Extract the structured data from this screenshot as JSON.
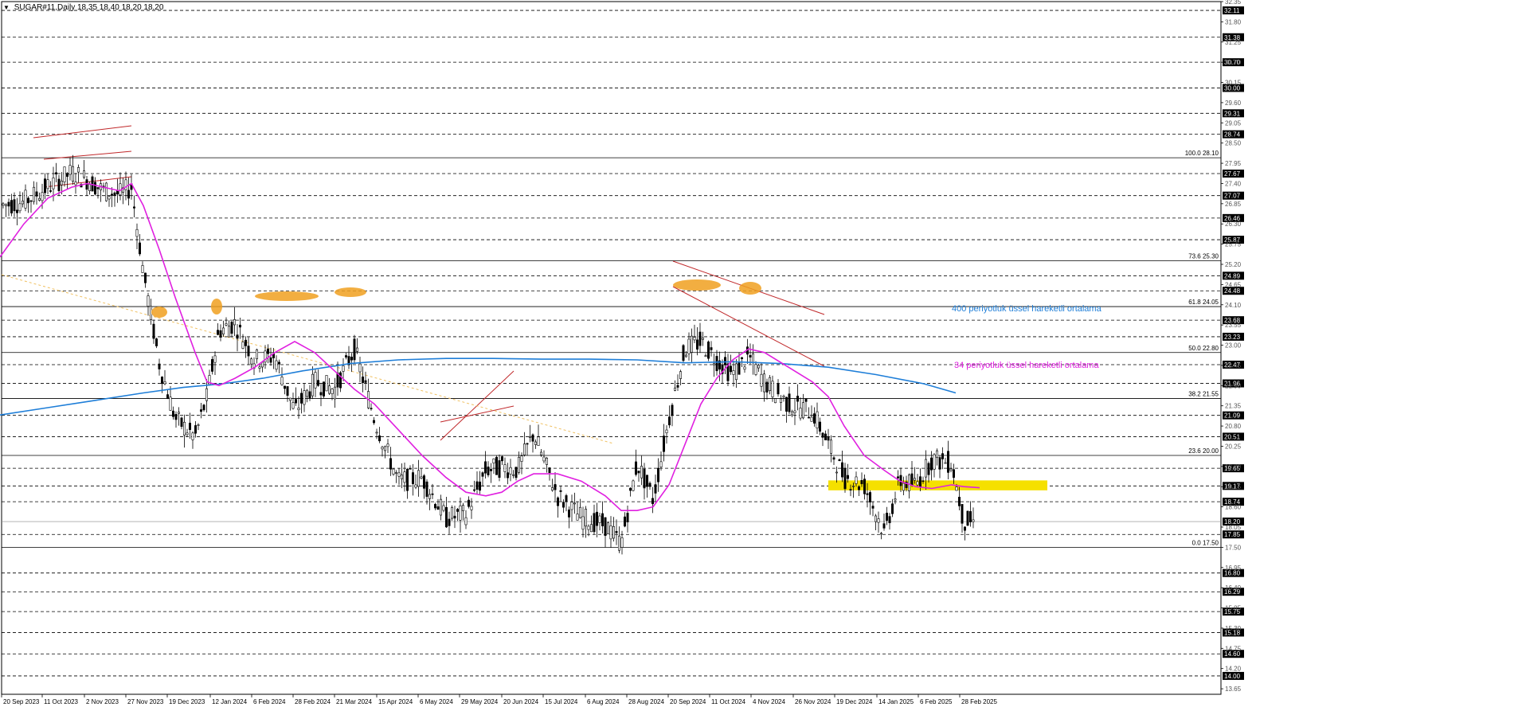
{
  "header": {
    "symbol": "SUGAR#11,Daily",
    "ohlc": "18.35 18.40 18.20 18.20"
  },
  "colors": {
    "background": "#ffffff",
    "candle": "#000000",
    "ema34": "#e020e0",
    "ema400": "#1e7ed8",
    "fib": "#000000",
    "support_zone": "#f5e000",
    "turn_marker": "#f0a020",
    "channel": "#c0282a",
    "long_trend": "#f0c060",
    "price_box": "#000000"
  },
  "chart_data": {
    "type": "candlestick",
    "title": "SUGAR#11,Daily",
    "ylim": [
      13.5,
      32.35
    ],
    "current_price": "18.20",
    "y_ticks": [
      "32.35",
      "31.80",
      "31.25",
      "30.70",
      "30.15",
      "29.60",
      "29.05",
      "28.50",
      "27.95",
      "27.40",
      "26.85",
      "26.30",
      "25.75",
      "25.20",
      "24.65",
      "24.10",
      "23.55",
      "23.00",
      "22.45",
      "21.90",
      "21.35",
      "20.80",
      "20.25",
      "19.70",
      "19.15",
      "18.60",
      "18.05",
      "17.50",
      "16.95",
      "16.40",
      "15.85",
      "15.30",
      "14.75",
      "14.20",
      "13.65"
    ],
    "x_labels": [
      "20 Sep 2023",
      "11 Oct 2023",
      "2 Nov 2023",
      "27 Nov 2023",
      "19 Dec 2023",
      "12 Jan 2024",
      "6 Feb 2024",
      "28 Feb 2024",
      "21 Mar 2024",
      "15 Apr 2024",
      "6 May 2024",
      "29 May 2024",
      "20 Jun 2024",
      "15 Jul 2024",
      "6 Aug 2024",
      "28 Aug 2024",
      "20 Sep 2024",
      "11 Oct 2024",
      "4 Nov 2024",
      "26 Nov 2024",
      "19 Dec 2024",
      "14 Jan 2025",
      "6 Feb 2025",
      "28 Feb 2025"
    ],
    "price_levels": [
      {
        "value": 32.11,
        "label": "32.11"
      },
      {
        "value": 31.38,
        "label": "31.38"
      },
      {
        "value": 30.7,
        "label": "30.70"
      },
      {
        "value": 30.0,
        "label": "30.00"
      },
      {
        "value": 29.31,
        "label": "29.31"
      },
      {
        "value": 28.74,
        "label": "28.74"
      },
      {
        "value": 27.67,
        "label": "27.67"
      },
      {
        "value": 27.07,
        "label": "27.07"
      },
      {
        "value": 26.46,
        "label": "26.46"
      },
      {
        "value": 25.87,
        "label": "25.87"
      },
      {
        "value": 24.89,
        "label": "24.89"
      },
      {
        "value": 24.48,
        "label": "24.48"
      },
      {
        "value": 23.68,
        "label": "23.68"
      },
      {
        "value": 23.23,
        "label": "23.23"
      },
      {
        "value": 22.47,
        "label": "22.47"
      },
      {
        "value": 21.96,
        "label": "21.96"
      },
      {
        "value": 21.09,
        "label": "21.09"
      },
      {
        "value": 20.51,
        "label": "20.51"
      },
      {
        "value": 19.65,
        "label": "19.65"
      },
      {
        "value": 19.17,
        "label": "19.17"
      },
      {
        "value": 18.74,
        "label": "18.74"
      },
      {
        "value": 17.85,
        "label": "17.85"
      },
      {
        "value": 16.8,
        "label": "16.80"
      },
      {
        "value": 16.29,
        "label": "16.29"
      },
      {
        "value": 15.75,
        "label": "15.75"
      },
      {
        "value": 15.18,
        "label": "15.18"
      },
      {
        "value": 14.6,
        "label": "14.60"
      },
      {
        "value": 14.0,
        "label": "14.00"
      }
    ],
    "fib_levels": [
      {
        "value": 28.1,
        "label": "100.0 28.10"
      },
      {
        "value": 25.3,
        "label": "73.6 25.30"
      },
      {
        "value": 24.05,
        "label": "61.8 24.05"
      },
      {
        "value": 22.8,
        "label": "50.0 22.80"
      },
      {
        "value": 21.55,
        "label": "38.2 21.55"
      },
      {
        "value": 20.0,
        "label": "23.6 20.00"
      },
      {
        "value": 17.5,
        "label": "0.0 17.50"
      }
    ],
    "series": [
      {
        "name": "400 periyotluk üssel hareketli ortalama",
        "x": [
          0,
          60,
          120,
          180,
          230,
          280,
          330,
          380,
          440,
          500,
          560,
          620,
          680,
          740,
          800,
          860,
          920,
          980,
          1040,
          1100,
          1160,
          1200
        ],
        "values": [
          21.1,
          21.3,
          21.5,
          21.7,
          21.85,
          21.95,
          22.1,
          22.3,
          22.5,
          22.6,
          22.64,
          22.64,
          22.62,
          22.62,
          22.6,
          22.52,
          22.55,
          22.5,
          22.4,
          22.2,
          21.95,
          21.7
        ]
      },
      {
        "name": "34 periyotluk üssel hareketli ortalama",
        "x": [
          0,
          30,
          60,
          90,
          110,
          130,
          150,
          165,
          180,
          200,
          220,
          245,
          260,
          275,
          295,
          320,
          345,
          370,
          395,
          420,
          445,
          470,
          500,
          530,
          560,
          585,
          610,
          630,
          650,
          670,
          700,
          730,
          760,
          780,
          800,
          820,
          840,
          860,
          880,
          900,
          920,
          940,
          960,
          990,
          1020,
          1040,
          1060,
          1085,
          1110,
          1130,
          1150,
          1170,
          1195,
          1210,
          1230
        ],
        "values": [
          25.4,
          26.3,
          27.0,
          27.3,
          27.4,
          27.3,
          27.2,
          27.4,
          26.8,
          25.6,
          24.3,
          22.8,
          22.0,
          21.9,
          22.1,
          22.4,
          22.8,
          23.1,
          22.8,
          22.3,
          21.8,
          21.4,
          20.7,
          20.0,
          19.4,
          19.0,
          18.9,
          19.0,
          19.3,
          19.5,
          19.5,
          19.3,
          18.9,
          18.5,
          18.5,
          18.6,
          19.2,
          20.3,
          21.4,
          22.1,
          22.6,
          22.9,
          22.8,
          22.4,
          22.0,
          21.6,
          20.8,
          20.0,
          19.6,
          19.3,
          19.15,
          19.1,
          19.2,
          19.15,
          19.12
        ]
      }
    ],
    "annotations": [
      {
        "text": "400 periyotluk üssel hareketli ortalama",
        "color": "#1e7ed8"
      },
      {
        "text": "34 periyotluk üssel hareketli ortalama",
        "color": "#e020e0"
      }
    ],
    "support_zone": {
      "low": 19.05,
      "high": 19.32
    },
    "grid": true,
    "legend": "none"
  }
}
